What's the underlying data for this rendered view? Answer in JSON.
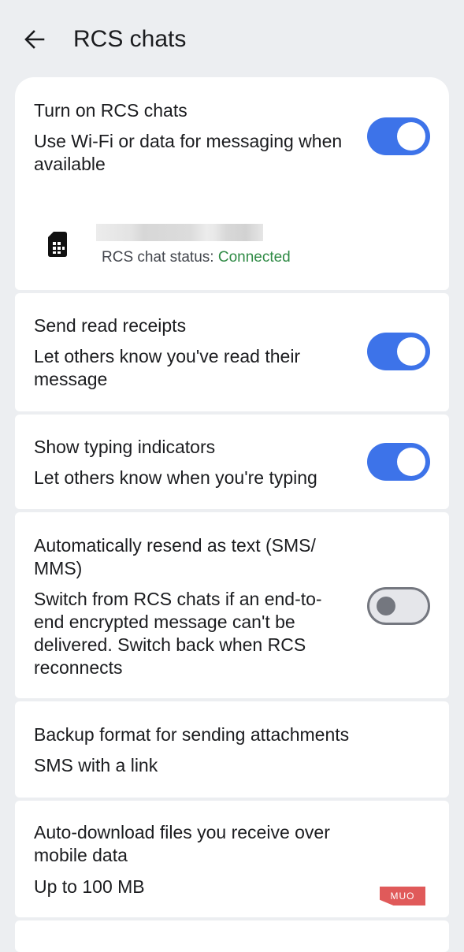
{
  "header": {
    "title": "RCS chats",
    "back_icon": "arrow-left-icon"
  },
  "rcs": {
    "title": "Turn on RCS chats",
    "subtitle": "Use Wi-Fi or data for messaging when available",
    "enabled": true,
    "sim_icon": "sim-card-icon",
    "status_label": "RCS chat status: ",
    "status_value": "Connected",
    "status_color": "#2f8a45"
  },
  "read_receipts": {
    "title": "Send read receipts",
    "subtitle": "Let others know you've read their message",
    "enabled": true
  },
  "typing": {
    "title": "Show typing indicators",
    "subtitle": "Let others know when you're typing",
    "enabled": true
  },
  "resend": {
    "title": "Automatically resend as text (SMS/ MMS)",
    "subtitle": "Switch from RCS chats if an end-to-end encrypted message can't be delivered. Switch back when RCS reconnects",
    "enabled": false
  },
  "backup": {
    "title": "Backup format for sending attachments",
    "value": "SMS with a link"
  },
  "autodownload": {
    "title": "Auto-download files you receive over mobile data",
    "value": "Up to 100 MB"
  },
  "watermark": {
    "text": "MUO"
  },
  "colors": {
    "accent": "#3d73e9",
    "background": "#eceef1",
    "card": "#ffffff"
  }
}
